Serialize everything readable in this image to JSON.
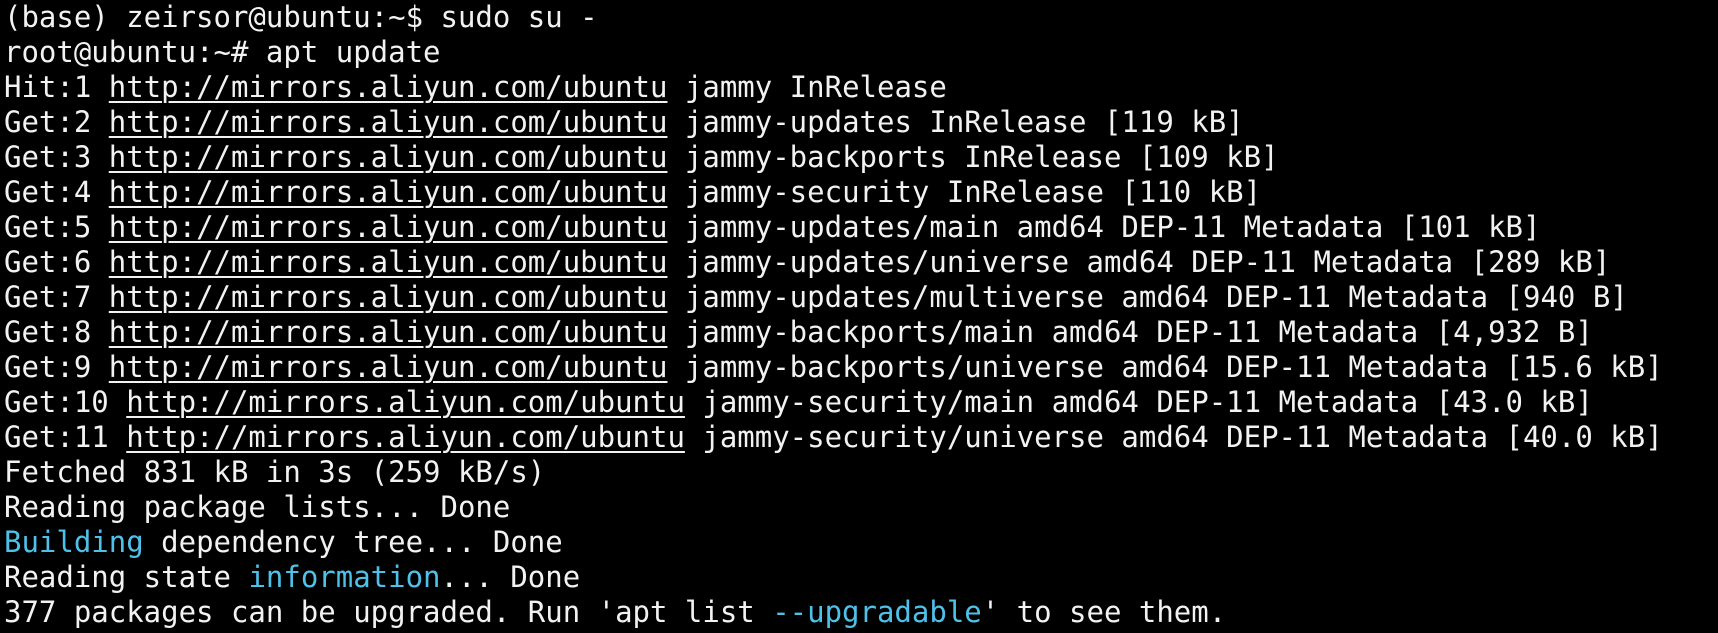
{
  "terminal": {
    "colors": {
      "background": "#000000",
      "foreground": "#f2f2f2",
      "highlight": "#4fc1e9"
    },
    "prompt1": {
      "prompt": "(base) zeirsor@ubuntu:~$ ",
      "command": "sudo su -"
    },
    "prompt2": {
      "prompt": "root@ubuntu:~# ",
      "command": "apt update"
    },
    "fetch_lines": [
      {
        "prefix": "Hit:1 ",
        "url": "http://mirrors.aliyun.com/ubuntu",
        "rest": " jammy InRelease"
      },
      {
        "prefix": "Get:2 ",
        "url": "http://mirrors.aliyun.com/ubuntu",
        "rest": " jammy-updates InRelease [119 kB]"
      },
      {
        "prefix": "Get:3 ",
        "url": "http://mirrors.aliyun.com/ubuntu",
        "rest": " jammy-backports InRelease [109 kB]"
      },
      {
        "prefix": "Get:4 ",
        "url": "http://mirrors.aliyun.com/ubuntu",
        "rest": " jammy-security InRelease [110 kB]"
      },
      {
        "prefix": "Get:5 ",
        "url": "http://mirrors.aliyun.com/ubuntu",
        "rest": " jammy-updates/main amd64 DEP-11 Metadata [101 kB]"
      },
      {
        "prefix": "Get:6 ",
        "url": "http://mirrors.aliyun.com/ubuntu",
        "rest": " jammy-updates/universe amd64 DEP-11 Metadata [289 kB]"
      },
      {
        "prefix": "Get:7 ",
        "url": "http://mirrors.aliyun.com/ubuntu",
        "rest": " jammy-updates/multiverse amd64 DEP-11 Metadata [940 B]"
      },
      {
        "prefix": "Get:8 ",
        "url": "http://mirrors.aliyun.com/ubuntu",
        "rest": " jammy-backports/main amd64 DEP-11 Metadata [4,932 B]"
      },
      {
        "prefix": "Get:9 ",
        "url": "http://mirrors.aliyun.com/ubuntu",
        "rest": " jammy-backports/universe amd64 DEP-11 Metadata [15.6 kB]"
      },
      {
        "prefix": "Get:10 ",
        "url": "http://mirrors.aliyun.com/ubuntu",
        "rest": " jammy-security/main amd64 DEP-11 Metadata [43.0 kB]"
      },
      {
        "prefix": "Get:11 ",
        "url": "http://mirrors.aliyun.com/ubuntu",
        "rest": " jammy-security/universe amd64 DEP-11 Metadata [40.0 kB]"
      }
    ],
    "fetched": "Fetched 831 kB in 3s (259 kB/s)",
    "reading_lists": "Reading package lists... Done",
    "building": {
      "word": "Building",
      "rest": " dependency tree... Done"
    },
    "state": {
      "before": "Reading state ",
      "word": "information",
      "after": "... Done"
    },
    "upgrade": {
      "before": "377 packages can be upgraded. Run 'apt list ",
      "flag": "--upgradable",
      "after": "' to see them."
    }
  }
}
